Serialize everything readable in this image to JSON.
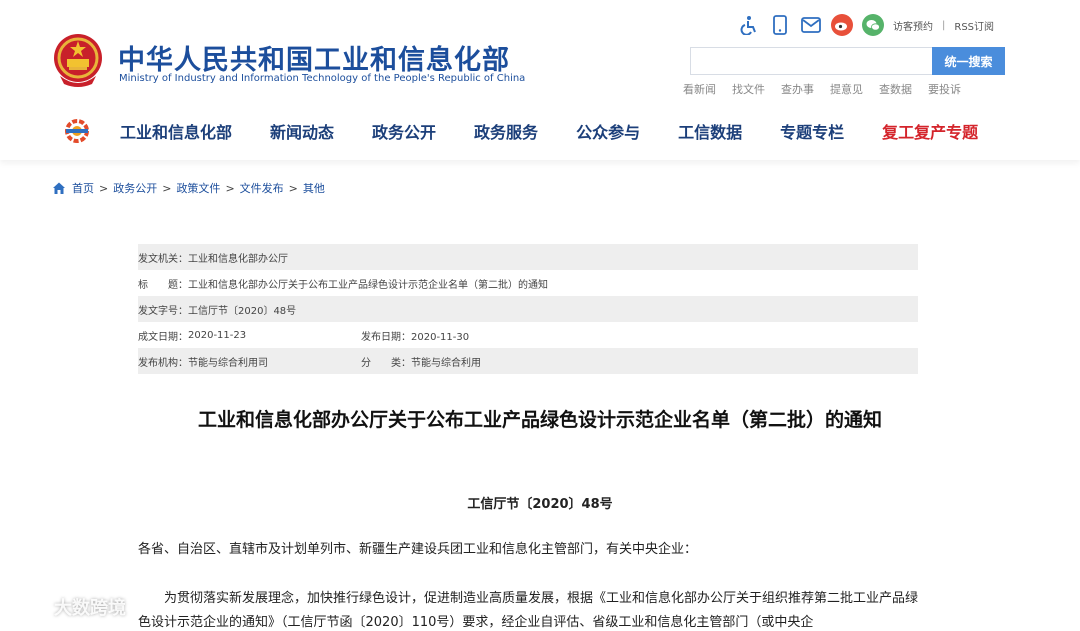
{
  "header": {
    "title": "中华人民共和国工业和信息化部",
    "subtitle": "Ministry of Industry and Information Technology of the People's Republic of China",
    "tools": {
      "icons": [
        "accessibility-icon",
        "mobile-icon",
        "mail-icon",
        "weibo-icon",
        "wechat-icon"
      ],
      "visitor_link": "访客预约",
      "separator": "|",
      "rss_link": "RSS订阅"
    },
    "search": {
      "placeholder": "",
      "button_label": "统一搜索"
    },
    "quick_links": [
      "看新闻",
      "找文件",
      "查办事",
      "提意见",
      "查数据",
      "要投诉"
    ],
    "nav": [
      "工业和信息化部",
      "新闻动态",
      "政务公开",
      "政务服务",
      "公众参与",
      "工信数据",
      "专题专栏",
      "复工复产专题"
    ]
  },
  "breadcrumb": [
    "首页",
    "政务公开",
    "政策文件",
    "文件发布",
    "其他"
  ],
  "info": {
    "issuer_label": "发文机关：",
    "issuer": "工业和信息化部办公厅",
    "title_label": "标　　题：",
    "title": "工业和信息化部办公厅关于公布工业产品绿色设计示范企业名单（第二批）的通知",
    "doc_no_label": "发文字号：",
    "doc_no": "工信厅节〔2020〕48号",
    "written_label": "成文日期：",
    "written": "2020-11-23",
    "published_label": "发布日期：",
    "published": "2020-11-30",
    "org_label": "发布机构：",
    "org": "节能与综合利用司",
    "category_label": "分　　类：",
    "category": "节能与综合利用"
  },
  "article": {
    "title": "工业和信息化部办公厅关于公布工业产品绿色设计示范企业名单（第二批）的通知",
    "number": "工信厅节〔2020〕48号",
    "para1": "各省、自治区、直辖市及计划单列市、新疆生产建设兵团工业和信息化主管部门，有关中央企业：",
    "para2": "为贯彻落实新发展理念，加快推行绿色设计，促进制造业高质量发展，根据《工业和信息化部办公厅关于组织推荐第二批工业产品绿色设计示范企业的通知》（工信厅节函〔2020〕110号）要求，经企业自评估、省级工业和信息化主管部门（或中央企"
  },
  "watermark": "大数跨境",
  "colors": {
    "brand_blue": "#1c4e9c",
    "nav_blue": "#1c3f7a",
    "accent_red": "#d4242b",
    "search_blue": "#4a8ddc"
  }
}
